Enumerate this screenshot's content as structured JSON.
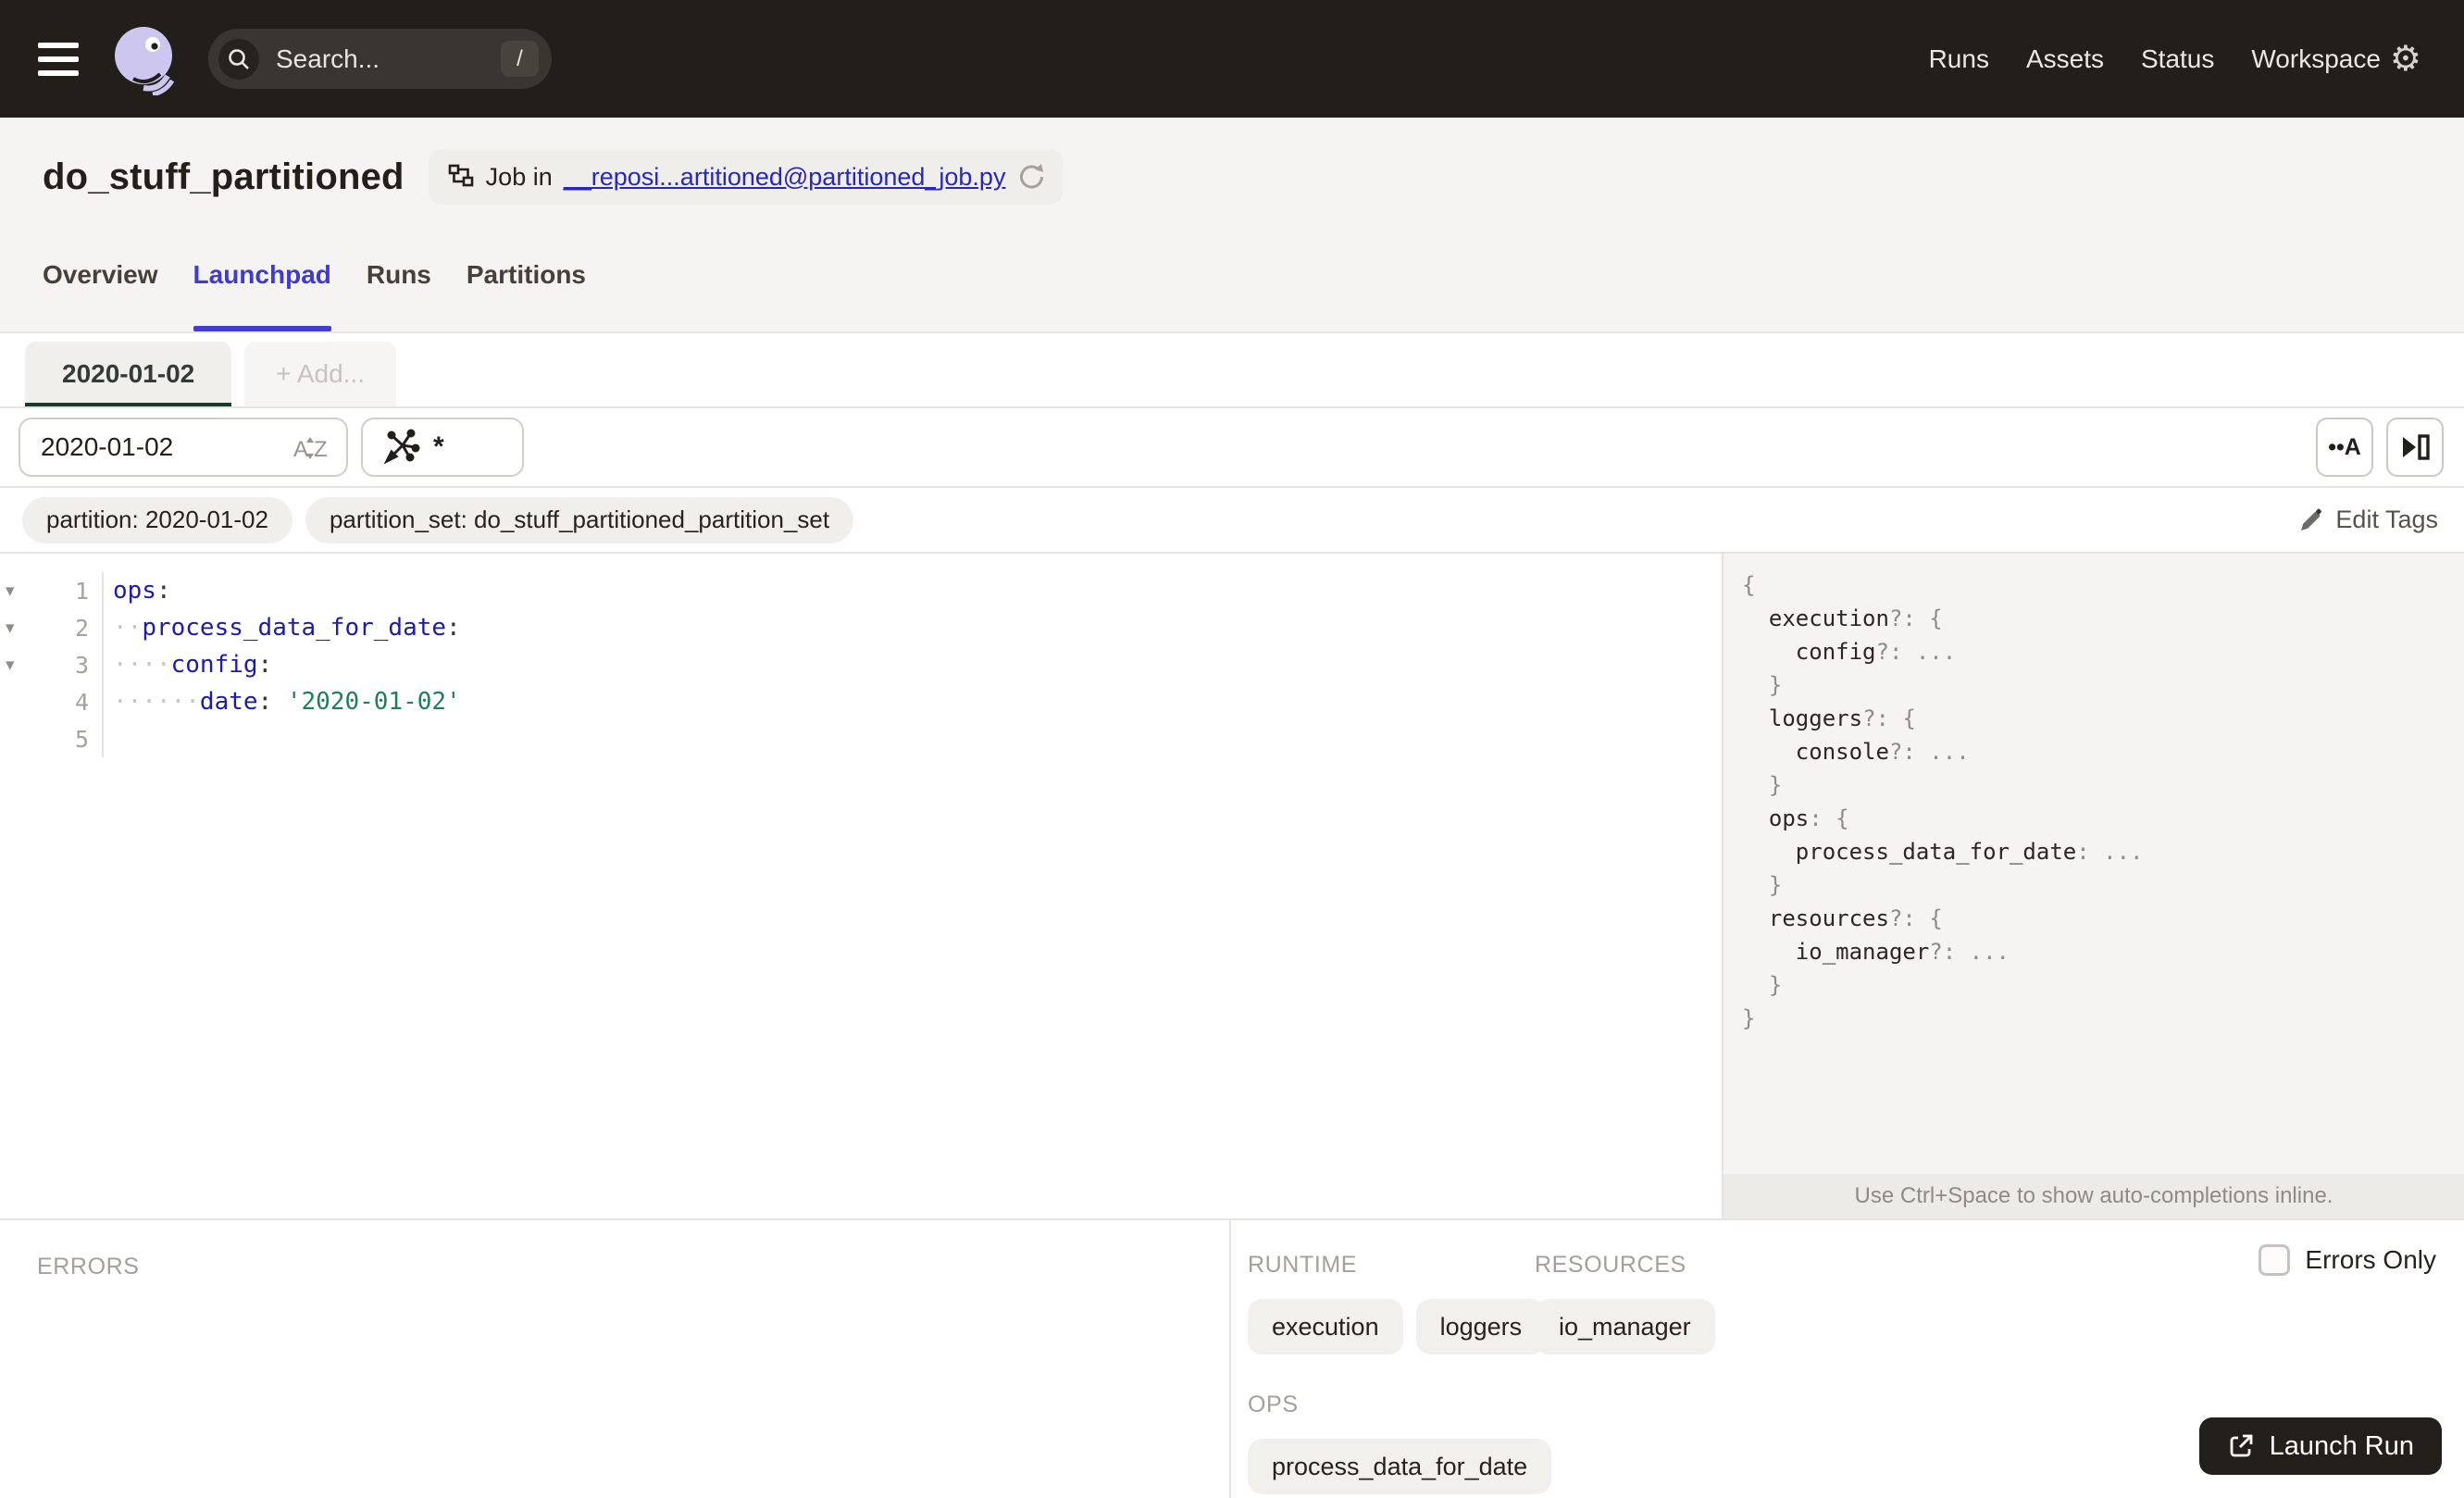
{
  "topbar": {
    "search_placeholder": "Search...",
    "search_shortcut": "/",
    "nav": [
      "Runs",
      "Assets",
      "Status",
      "Workspace"
    ],
    "gear_glyph": "⚙"
  },
  "header": {
    "title": "do_stuff_partitioned",
    "badge_prefix": "Job in",
    "badge_link": "__reposi...artitioned@partitioned_job.py"
  },
  "tabs": [
    {
      "label": "Overview",
      "active": false
    },
    {
      "label": "Launchpad",
      "active": true
    },
    {
      "label": "Runs",
      "active": false
    },
    {
      "label": "Partitions",
      "active": false
    }
  ],
  "partition_tabs": {
    "active": "2020-01-02",
    "add": "+ Add..."
  },
  "toolbar": {
    "partition_value": "2020-01-02",
    "op_selector_value": "*",
    "whitespace_toggle": "••A"
  },
  "tags": {
    "items": [
      "partition: 2020-01-02",
      "partition_set: do_stuff_partitioned_partition_set"
    ],
    "edit_label": "Edit Tags"
  },
  "editor": {
    "lines": [
      {
        "num": "1",
        "fold": true,
        "segs": [
          {
            "c": "key",
            "t": "ops"
          },
          {
            "c": "punct",
            "t": ":"
          }
        ]
      },
      {
        "num": "2",
        "fold": true,
        "segs": [
          {
            "c": "ws",
            "t": "··"
          },
          {
            "c": "key",
            "t": "process_data_for_date"
          },
          {
            "c": "punct",
            "t": ":"
          }
        ]
      },
      {
        "num": "3",
        "fold": true,
        "segs": [
          {
            "c": "ws",
            "t": "····"
          },
          {
            "c": "key",
            "t": "config"
          },
          {
            "c": "punct",
            "t": ":"
          }
        ]
      },
      {
        "num": "4",
        "fold": false,
        "segs": [
          {
            "c": "ws",
            "t": "······"
          },
          {
            "c": "key",
            "t": "date"
          },
          {
            "c": "punct",
            "t": ":"
          },
          {
            "c": "plain",
            "t": " "
          },
          {
            "c": "str",
            "t": "'2020-01-02'"
          }
        ]
      },
      {
        "num": "5",
        "fold": false,
        "segs": []
      }
    ]
  },
  "schema": {
    "lines": [
      [
        {
          "c": "p",
          "t": "{"
        }
      ],
      [
        {
          "c": "plain",
          "t": "  "
        },
        {
          "c": "k",
          "t": "execution"
        },
        {
          "c": "p",
          "t": "?: {"
        }
      ],
      [
        {
          "c": "plain",
          "t": "    "
        },
        {
          "c": "k",
          "t": "config"
        },
        {
          "c": "p",
          "t": "?: ..."
        }
      ],
      [
        {
          "c": "plain",
          "t": "  "
        },
        {
          "c": "p",
          "t": "}"
        }
      ],
      [
        {
          "c": "plain",
          "t": "  "
        },
        {
          "c": "k",
          "t": "loggers"
        },
        {
          "c": "p",
          "t": "?: {"
        }
      ],
      [
        {
          "c": "plain",
          "t": "    "
        },
        {
          "c": "k",
          "t": "console"
        },
        {
          "c": "p",
          "t": "?: ..."
        }
      ],
      [
        {
          "c": "plain",
          "t": "  "
        },
        {
          "c": "p",
          "t": "}"
        }
      ],
      [
        {
          "c": "plain",
          "t": "  "
        },
        {
          "c": "k",
          "t": "ops"
        },
        {
          "c": "p",
          "t": ": {"
        }
      ],
      [
        {
          "c": "plain",
          "t": "    "
        },
        {
          "c": "k",
          "t": "process_data_for_date"
        },
        {
          "c": "p",
          "t": ": ..."
        }
      ],
      [
        {
          "c": "plain",
          "t": "  "
        },
        {
          "c": "p",
          "t": "}"
        }
      ],
      [
        {
          "c": "plain",
          "t": "  "
        },
        {
          "c": "k",
          "t": "resources"
        },
        {
          "c": "p",
          "t": "?: {"
        }
      ],
      [
        {
          "c": "plain",
          "t": "    "
        },
        {
          "c": "k",
          "t": "io_manager"
        },
        {
          "c": "p",
          "t": "?: ..."
        }
      ],
      [
        {
          "c": "plain",
          "t": "  "
        },
        {
          "c": "p",
          "t": "}"
        }
      ],
      [
        {
          "c": "p",
          "t": "}"
        }
      ]
    ],
    "hint": "Use Ctrl+Space to show auto-completions inline."
  },
  "bottom": {
    "errors_label": "ERRORS",
    "runtime_label": "RUNTIME",
    "runtime_tags": [
      "execution",
      "loggers"
    ],
    "resources_label": "RESOURCES",
    "resources_tags": [
      "io_manager"
    ],
    "ops_label": "OPS",
    "ops_tags": [
      "process_data_for_date"
    ],
    "errors_only_label": "Errors Only",
    "launch_label": "Launch Run"
  },
  "colors": {
    "topbar_bg": "#221E1A",
    "accent_indigo": "#3F3AD2",
    "link_blue": "#2727BE",
    "yaml_key": "#1C1CAA",
    "yaml_string": "#1E8058",
    "active_partition_underline": "#1A3A30",
    "launch_button_bg": "#231F1B"
  }
}
